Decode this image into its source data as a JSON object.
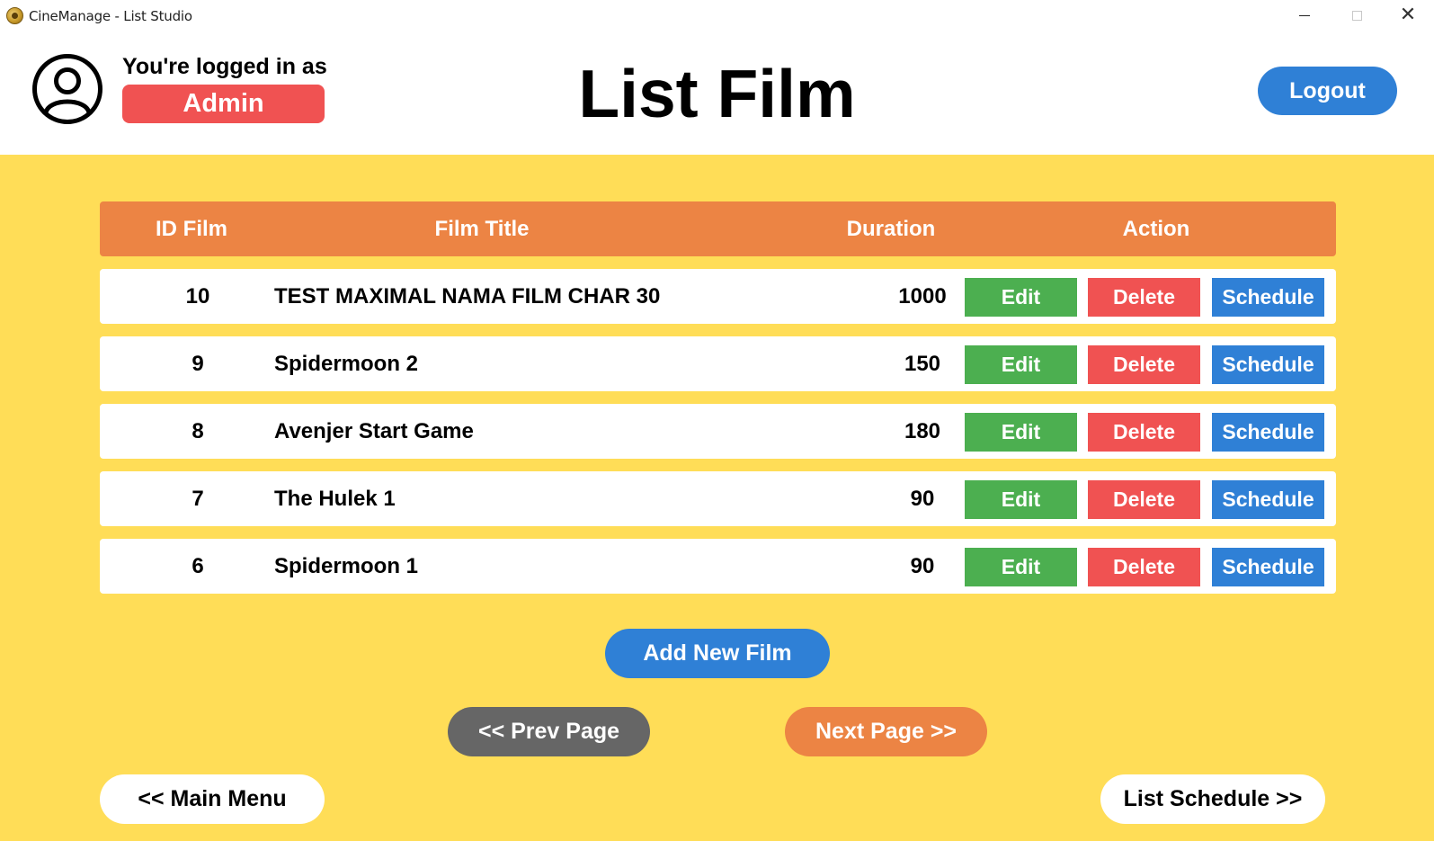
{
  "window": {
    "title": "CineManage - List Studio",
    "minimize_icon": "minimize-icon",
    "maximize_icon": "maximize-icon",
    "close_icon": "close-icon",
    "close_glyph": "✕"
  },
  "header": {
    "logged_in_label": "You're logged in as",
    "role": "Admin",
    "page_title": "List Film",
    "logout_label": "Logout"
  },
  "table": {
    "columns": [
      "ID Film",
      "Film Title",
      "Duration",
      "Action"
    ],
    "rows": [
      {
        "id": "10",
        "title": "TEST MAXIMAL NAMA FILM CHAR 30",
        "duration": "1000",
        "edit": "Edit",
        "delete": "Delete",
        "schedule": "Schedule"
      },
      {
        "id": "9",
        "title": "Spidermoon 2",
        "duration": "150",
        "edit": "Edit",
        "delete": "Delete",
        "schedule": "Schedule"
      },
      {
        "id": "8",
        "title": "Avenjer Start Game",
        "duration": "180",
        "edit": "Edit",
        "delete": "Delete",
        "schedule": "Schedule"
      },
      {
        "id": "7",
        "title": "The Hulek 1",
        "duration": "90",
        "edit": "Edit",
        "delete": "Delete",
        "schedule": "Schedule"
      },
      {
        "id": "6",
        "title": "Spidermoon 1",
        "duration": "90",
        "edit": "Edit",
        "delete": "Delete",
        "schedule": "Schedule"
      }
    ]
  },
  "actions": {
    "add_new_film": "Add New Film",
    "prev_page": "<< Prev Page",
    "next_page": "Next Page >>",
    "main_menu": "<< Main Menu",
    "list_schedule": "List Schedule >>"
  },
  "colors": {
    "background": "#ffdd57",
    "header_row": "#ec8444",
    "edit": "#4caf50",
    "delete": "#f05252",
    "schedule": "#2f80d6",
    "prev": "#666666"
  }
}
